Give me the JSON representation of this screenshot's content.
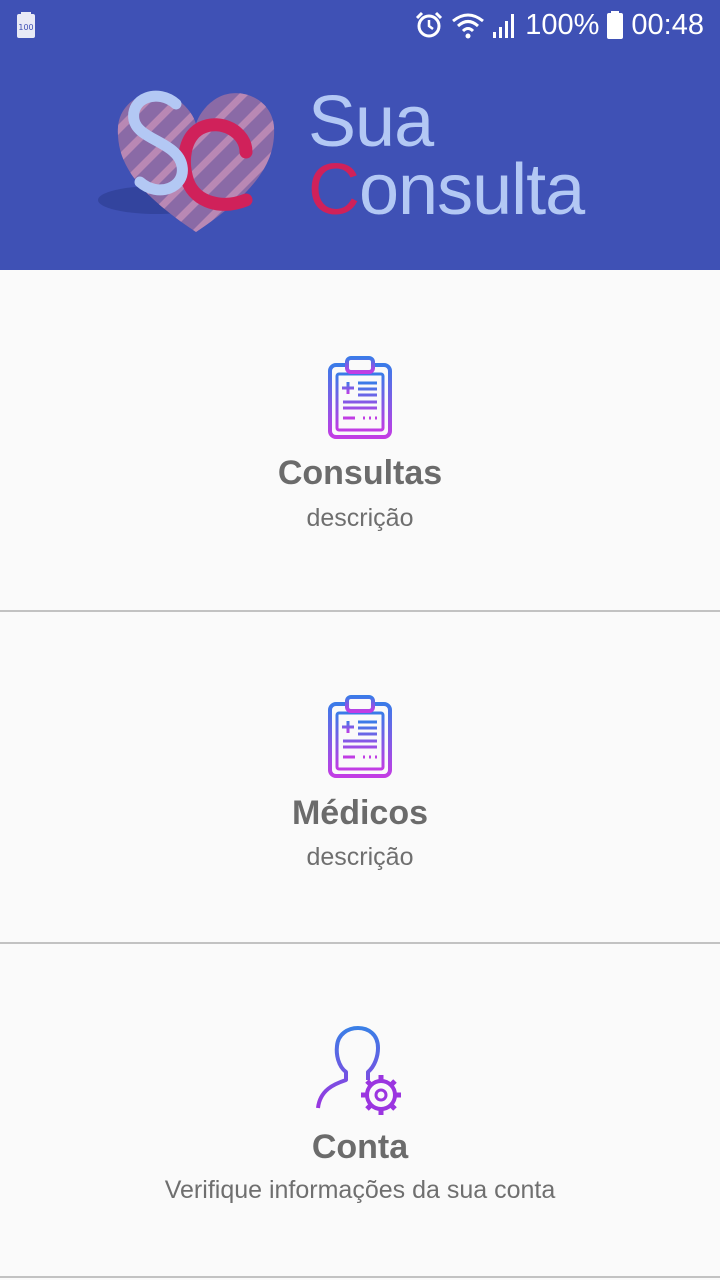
{
  "status_bar": {
    "battery_badge": "100",
    "battery_percent": "100%",
    "time": "00:48",
    "icons": [
      "battery-saver-icon",
      "alarm-icon",
      "wifi-icon",
      "signal-icon",
      "battery-icon"
    ]
  },
  "header": {
    "logo_word1": "Sua",
    "logo_word2_accent": "C",
    "logo_word2_rest": "onsulta",
    "colors": {
      "background": "#3f51b5",
      "logo_text": "#b3c8f4",
      "logo_accent": "#d0215a"
    }
  },
  "menu": [
    {
      "title": "Consultas",
      "description": "descrição",
      "icon": "clipboard-icon"
    },
    {
      "title": "Médicos",
      "description": "descrição",
      "icon": "clipboard-icon"
    },
    {
      "title": "Conta",
      "description": "Verifique informações da sua conta",
      "icon": "user-settings-icon"
    }
  ]
}
